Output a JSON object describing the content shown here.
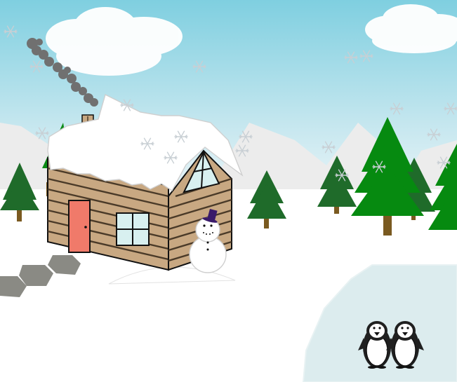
{
  "scene": {
    "kind": "winter-cabin-illustration",
    "text_visible": false,
    "colors": {
      "sky_top": "#7fcfe0",
      "sky_bottom": "#f2f8fa",
      "mountain": "#ececec",
      "snow": "#ffffff",
      "log_wall": "#c8a882",
      "log_line": "#4a3a28",
      "door": "#f07a6a",
      "window_glass": "#d8f0f0",
      "chimney": "#c8a882",
      "smoke": "#707070",
      "pine_dark": "#1f6b2a",
      "pine_bright": "#068a10",
      "trunk": "#7a5a20",
      "ice_pond": "#dcecee",
      "stepping_stone": "#8a8a84",
      "snowman_hat": "#3a1a6a",
      "penguin_body": "#202020",
      "penguin_belly": "#ffffff"
    },
    "icons": [
      "cloud-icon",
      "snowflake-icon",
      "pine-tree-icon",
      "log-cabin-icon",
      "snowman-icon",
      "penguin-icon",
      "chimney-smoke-icon",
      "stepping-stone-icon",
      "ice-pond-icon"
    ],
    "counts": {
      "penguins": 2,
      "snowmen": 1,
      "cabins": 1
    }
  }
}
